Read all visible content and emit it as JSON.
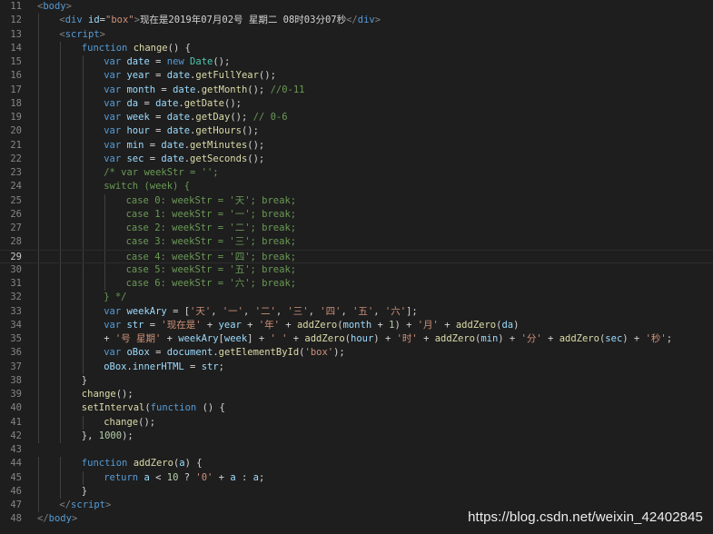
{
  "editor": {
    "current_line": 29,
    "lines": [
      {
        "n": "11",
        "indent": 0,
        "tokens": [
          [
            "t-punc",
            "<"
          ],
          [
            "t-tag",
            "body"
          ],
          [
            "t-punc",
            ">"
          ]
        ]
      },
      {
        "n": "12",
        "indent": 1,
        "tokens": [
          [
            "t-punc",
            "<"
          ],
          [
            "t-tag",
            "div"
          ],
          [
            "t-plain",
            " "
          ],
          [
            "t-attr",
            "id"
          ],
          [
            "t-plain",
            "="
          ],
          [
            "t-str",
            "\"box\""
          ],
          [
            "t-punc",
            ">"
          ],
          [
            "t-plain",
            "现在是2019年07月02号 星期二 08时03分07秒"
          ],
          [
            "t-punc",
            "</"
          ],
          [
            "t-tag",
            "div"
          ],
          [
            "t-punc",
            ">"
          ]
        ]
      },
      {
        "n": "13",
        "indent": 1,
        "tokens": [
          [
            "t-punc",
            "<"
          ],
          [
            "t-tag",
            "script"
          ],
          [
            "t-punc",
            ">"
          ]
        ]
      },
      {
        "n": "14",
        "indent": 2,
        "tokens": [
          [
            "t-kw",
            "function"
          ],
          [
            "t-plain",
            " "
          ],
          [
            "t-fn",
            "change"
          ],
          [
            "t-plain",
            "() {"
          ]
        ]
      },
      {
        "n": "15",
        "indent": 3,
        "tokens": [
          [
            "t-kw",
            "var"
          ],
          [
            "t-plain",
            " "
          ],
          [
            "t-var",
            "date"
          ],
          [
            "t-plain",
            " = "
          ],
          [
            "t-kw",
            "new"
          ],
          [
            "t-plain",
            " "
          ],
          [
            "t-cls",
            "Date"
          ],
          [
            "t-plain",
            "();"
          ]
        ]
      },
      {
        "n": "16",
        "indent": 3,
        "tokens": [
          [
            "t-kw",
            "var"
          ],
          [
            "t-plain",
            " "
          ],
          [
            "t-var",
            "year"
          ],
          [
            "t-plain",
            " = "
          ],
          [
            "t-var",
            "date"
          ],
          [
            "t-plain",
            "."
          ],
          [
            "t-fn",
            "getFullYear"
          ],
          [
            "t-plain",
            "();"
          ]
        ]
      },
      {
        "n": "17",
        "indent": 3,
        "tokens": [
          [
            "t-kw",
            "var"
          ],
          [
            "t-plain",
            " "
          ],
          [
            "t-var",
            "month"
          ],
          [
            "t-plain",
            " = "
          ],
          [
            "t-var",
            "date"
          ],
          [
            "t-plain",
            "."
          ],
          [
            "t-fn",
            "getMonth"
          ],
          [
            "t-plain",
            "(); "
          ],
          [
            "t-com",
            "//0-11"
          ]
        ]
      },
      {
        "n": "18",
        "indent": 3,
        "tokens": [
          [
            "t-kw",
            "var"
          ],
          [
            "t-plain",
            " "
          ],
          [
            "t-var",
            "da"
          ],
          [
            "t-plain",
            " = "
          ],
          [
            "t-var",
            "date"
          ],
          [
            "t-plain",
            "."
          ],
          [
            "t-fn",
            "getDate"
          ],
          [
            "t-plain",
            "();"
          ]
        ]
      },
      {
        "n": "19",
        "indent": 3,
        "tokens": [
          [
            "t-kw",
            "var"
          ],
          [
            "t-plain",
            " "
          ],
          [
            "t-var",
            "week"
          ],
          [
            "t-plain",
            " = "
          ],
          [
            "t-var",
            "date"
          ],
          [
            "t-plain",
            "."
          ],
          [
            "t-fn",
            "getDay"
          ],
          [
            "t-plain",
            "(); "
          ],
          [
            "t-com",
            "// 0-6"
          ]
        ]
      },
      {
        "n": "20",
        "indent": 3,
        "tokens": [
          [
            "t-kw",
            "var"
          ],
          [
            "t-plain",
            " "
          ],
          [
            "t-var",
            "hour"
          ],
          [
            "t-plain",
            " = "
          ],
          [
            "t-var",
            "date"
          ],
          [
            "t-plain",
            "."
          ],
          [
            "t-fn",
            "getHours"
          ],
          [
            "t-plain",
            "();"
          ]
        ]
      },
      {
        "n": "21",
        "indent": 3,
        "tokens": [
          [
            "t-kw",
            "var"
          ],
          [
            "t-plain",
            " "
          ],
          [
            "t-var",
            "min"
          ],
          [
            "t-plain",
            " = "
          ],
          [
            "t-var",
            "date"
          ],
          [
            "t-plain",
            "."
          ],
          [
            "t-fn",
            "getMinutes"
          ],
          [
            "t-plain",
            "();"
          ]
        ]
      },
      {
        "n": "22",
        "indent": 3,
        "tokens": [
          [
            "t-kw",
            "var"
          ],
          [
            "t-plain",
            " "
          ],
          [
            "t-var",
            "sec"
          ],
          [
            "t-plain",
            " = "
          ],
          [
            "t-var",
            "date"
          ],
          [
            "t-plain",
            "."
          ],
          [
            "t-fn",
            "getSeconds"
          ],
          [
            "t-plain",
            "();"
          ]
        ]
      },
      {
        "n": "23",
        "indent": 3,
        "tokens": [
          [
            "t-com",
            "/* var weekStr = '';"
          ]
        ]
      },
      {
        "n": "24",
        "indent": 3,
        "tokens": [
          [
            "t-com",
            "switch (week) {"
          ]
        ]
      },
      {
        "n": "25",
        "indent": 4,
        "tokens": [
          [
            "t-com",
            "case 0: weekStr = '天'; break;"
          ]
        ]
      },
      {
        "n": "26",
        "indent": 4,
        "tokens": [
          [
            "t-com",
            "case 1: weekStr = '一'; break;"
          ]
        ]
      },
      {
        "n": "27",
        "indent": 4,
        "tokens": [
          [
            "t-com",
            "case 2: weekStr = '二'; break;"
          ]
        ]
      },
      {
        "n": "28",
        "indent": 4,
        "tokens": [
          [
            "t-com",
            "case 3: weekStr = '三'; break;"
          ]
        ]
      },
      {
        "n": "29",
        "indent": 4,
        "tokens": [
          [
            "t-com",
            "case 4: weekStr = '四'; break;"
          ]
        ]
      },
      {
        "n": "30",
        "indent": 4,
        "tokens": [
          [
            "t-com",
            "case 5: weekStr = '五'; break;"
          ]
        ]
      },
      {
        "n": "31",
        "indent": 4,
        "tokens": [
          [
            "t-com",
            "case 6: weekStr = '六'; break;"
          ]
        ]
      },
      {
        "n": "32",
        "indent": 3,
        "tokens": [
          [
            "t-com",
            "} */"
          ]
        ]
      },
      {
        "n": "33",
        "indent": 3,
        "tokens": [
          [
            "t-kw",
            "var"
          ],
          [
            "t-plain",
            " "
          ],
          [
            "t-var",
            "weekAry"
          ],
          [
            "t-plain",
            " = ["
          ],
          [
            "t-str",
            "'天'"
          ],
          [
            "t-plain",
            ", "
          ],
          [
            "t-str",
            "'一'"
          ],
          [
            "t-plain",
            ", "
          ],
          [
            "t-str",
            "'二'"
          ],
          [
            "t-plain",
            ", "
          ],
          [
            "t-str",
            "'三'"
          ],
          [
            "t-plain",
            ", "
          ],
          [
            "t-str",
            "'四'"
          ],
          [
            "t-plain",
            ", "
          ],
          [
            "t-str",
            "'五'"
          ],
          [
            "t-plain",
            ", "
          ],
          [
            "t-str",
            "'六'"
          ],
          [
            "t-plain",
            "];"
          ]
        ]
      },
      {
        "n": "34",
        "indent": 3,
        "tokens": [
          [
            "t-kw",
            "var"
          ],
          [
            "t-plain",
            " "
          ],
          [
            "t-var",
            "str"
          ],
          [
            "t-plain",
            " = "
          ],
          [
            "t-str",
            "'现在是'"
          ],
          [
            "t-plain",
            " + "
          ],
          [
            "t-var",
            "year"
          ],
          [
            "t-plain",
            " + "
          ],
          [
            "t-str",
            "'年'"
          ],
          [
            "t-plain",
            " + "
          ],
          [
            "t-fn",
            "addZero"
          ],
          [
            "t-plain",
            "("
          ],
          [
            "t-var",
            "month"
          ],
          [
            "t-plain",
            " + "
          ],
          [
            "t-num",
            "1"
          ],
          [
            "t-plain",
            ") + "
          ],
          [
            "t-str",
            "'月'"
          ],
          [
            "t-plain",
            " + "
          ],
          [
            "t-fn",
            "addZero"
          ],
          [
            "t-plain",
            "("
          ],
          [
            "t-var",
            "da"
          ],
          [
            "t-plain",
            ")"
          ]
        ]
      },
      {
        "n": "35",
        "indent": 3,
        "tokens": [
          [
            "t-plain",
            "+ "
          ],
          [
            "t-str",
            "'号 星期'"
          ],
          [
            "t-plain",
            " + "
          ],
          [
            "t-var",
            "weekAry"
          ],
          [
            "t-plain",
            "["
          ],
          [
            "t-var",
            "week"
          ],
          [
            "t-plain",
            "] + "
          ],
          [
            "t-str",
            "' '"
          ],
          [
            "t-plain",
            " + "
          ],
          [
            "t-fn",
            "addZero"
          ],
          [
            "t-plain",
            "("
          ],
          [
            "t-var",
            "hour"
          ],
          [
            "t-plain",
            ") + "
          ],
          [
            "t-str",
            "'时'"
          ],
          [
            "t-plain",
            " + "
          ],
          [
            "t-fn",
            "addZero"
          ],
          [
            "t-plain",
            "("
          ],
          [
            "t-var",
            "min"
          ],
          [
            "t-plain",
            ") + "
          ],
          [
            "t-str",
            "'分'"
          ],
          [
            "t-plain",
            " + "
          ],
          [
            "t-fn",
            "addZero"
          ],
          [
            "t-plain",
            "("
          ],
          [
            "t-var",
            "sec"
          ],
          [
            "t-plain",
            ") + "
          ],
          [
            "t-str",
            "'秒'"
          ],
          [
            "t-plain",
            ";"
          ]
        ]
      },
      {
        "n": "36",
        "indent": 3,
        "tokens": [
          [
            "t-kw",
            "var"
          ],
          [
            "t-plain",
            " "
          ],
          [
            "t-var",
            "oBox"
          ],
          [
            "t-plain",
            " = "
          ],
          [
            "t-var",
            "document"
          ],
          [
            "t-plain",
            "."
          ],
          [
            "t-fn",
            "getElementById"
          ],
          [
            "t-plain",
            "("
          ],
          [
            "t-str",
            "'box'"
          ],
          [
            "t-plain",
            ");"
          ]
        ]
      },
      {
        "n": "37",
        "indent": 3,
        "tokens": [
          [
            "t-var",
            "oBox"
          ],
          [
            "t-plain",
            "."
          ],
          [
            "t-var",
            "innerHTML"
          ],
          [
            "t-plain",
            " = "
          ],
          [
            "t-var",
            "str"
          ],
          [
            "t-plain",
            ";"
          ]
        ]
      },
      {
        "n": "38",
        "indent": 2,
        "tokens": [
          [
            "t-plain",
            "}"
          ]
        ]
      },
      {
        "n": "39",
        "indent": 2,
        "tokens": [
          [
            "t-fn",
            "change"
          ],
          [
            "t-plain",
            "();"
          ]
        ]
      },
      {
        "n": "40",
        "indent": 2,
        "tokens": [
          [
            "t-fn",
            "setInterval"
          ],
          [
            "t-plain",
            "("
          ],
          [
            "t-kw",
            "function"
          ],
          [
            "t-plain",
            " () {"
          ]
        ]
      },
      {
        "n": "41",
        "indent": 3,
        "tokens": [
          [
            "t-fn",
            "change"
          ],
          [
            "t-plain",
            "();"
          ]
        ]
      },
      {
        "n": "42",
        "indent": 2,
        "tokens": [
          [
            "t-plain",
            "}, "
          ],
          [
            "t-num",
            "1000"
          ],
          [
            "t-plain",
            ");"
          ]
        ]
      },
      {
        "n": "43",
        "indent": 0,
        "tokens": []
      },
      {
        "n": "44",
        "indent": 2,
        "tokens": [
          [
            "t-kw",
            "function"
          ],
          [
            "t-plain",
            " "
          ],
          [
            "t-fn",
            "addZero"
          ],
          [
            "t-plain",
            "("
          ],
          [
            "t-var",
            "a"
          ],
          [
            "t-plain",
            ") {"
          ]
        ]
      },
      {
        "n": "45",
        "indent": 3,
        "tokens": [
          [
            "t-kw",
            "return"
          ],
          [
            "t-plain",
            " "
          ],
          [
            "t-var",
            "a"
          ],
          [
            "t-plain",
            " < "
          ],
          [
            "t-num",
            "10"
          ],
          [
            "t-plain",
            " ? "
          ],
          [
            "t-str",
            "'0'"
          ],
          [
            "t-plain",
            " + "
          ],
          [
            "t-var",
            "a"
          ],
          [
            "t-plain",
            " : "
          ],
          [
            "t-var",
            "a"
          ],
          [
            "t-plain",
            ";"
          ]
        ]
      },
      {
        "n": "46",
        "indent": 2,
        "tokens": [
          [
            "t-plain",
            "}"
          ]
        ]
      },
      {
        "n": "47",
        "indent": 1,
        "tokens": [
          [
            "t-punc",
            "</"
          ],
          [
            "t-tag",
            "script"
          ],
          [
            "t-punc",
            ">"
          ]
        ]
      },
      {
        "n": "48",
        "indent": 0,
        "tokens": [
          [
            "t-punc",
            "</"
          ],
          [
            "t-tag",
            "body"
          ],
          [
            "t-punc",
            ">"
          ]
        ]
      }
    ]
  },
  "watermark": "https://blog.csdn.net/weixin_42402845"
}
